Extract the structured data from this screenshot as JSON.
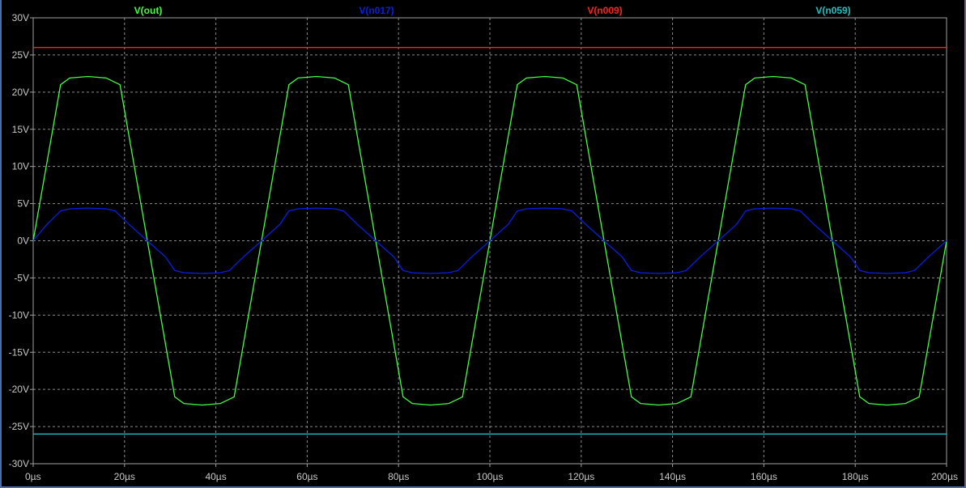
{
  "chart_data": {
    "type": "line",
    "x_unit": "µs",
    "xlim": [
      0,
      200
    ],
    "ylim": [
      -30,
      30
    ],
    "grid": true,
    "legend_placement": "top",
    "background": "#000000",
    "x_ticks": [
      {
        "value": 0,
        "label": "0µs"
      },
      {
        "value": 20,
        "label": "20µs"
      },
      {
        "value": 40,
        "label": "40µs"
      },
      {
        "value": 60,
        "label": "60µs"
      },
      {
        "value": 80,
        "label": "80µs"
      },
      {
        "value": 100,
        "label": "100µs"
      },
      {
        "value": 120,
        "label": "120µs"
      },
      {
        "value": 140,
        "label": "140µs"
      },
      {
        "value": 160,
        "label": "160µs"
      },
      {
        "value": 180,
        "label": "180µs"
      },
      {
        "value": 200,
        "label": "200µs"
      }
    ],
    "y_ticks": [
      {
        "value": 30,
        "label": "30V"
      },
      {
        "value": 25,
        "label": "25V"
      },
      {
        "value": 20,
        "label": "20V"
      },
      {
        "value": 15,
        "label": "15V"
      },
      {
        "value": 10,
        "label": "10V"
      },
      {
        "value": 5,
        "label": "5V"
      },
      {
        "value": 0,
        "label": "0V"
      },
      {
        "value": -5,
        "label": "-5V"
      },
      {
        "value": -10,
        "label": "-10V"
      },
      {
        "value": -15,
        "label": "-15V"
      },
      {
        "value": -20,
        "label": "-20V"
      },
      {
        "value": -25,
        "label": "-25V"
      },
      {
        "value": -30,
        "label": "-30V"
      }
    ],
    "series": [
      {
        "name": "V(out)",
        "color": "#40ff40",
        "x": [
          0,
          6,
          8,
          12,
          16,
          19,
          31,
          33,
          37,
          41,
          44,
          56,
          58,
          62,
          66,
          69,
          81,
          83,
          87,
          91,
          94,
          106,
          108,
          112,
          116,
          119,
          131,
          133,
          137,
          141,
          144,
          156,
          158,
          162,
          166,
          169,
          181,
          183,
          187,
          191,
          194,
          200
        ],
        "y": [
          0,
          21,
          21.9,
          22.1,
          21.9,
          21,
          -21,
          -21.9,
          -22.1,
          -21.9,
          -21,
          21,
          21.9,
          22.1,
          21.9,
          21,
          -21,
          -21.9,
          -22.1,
          -21.9,
          -21,
          21,
          21.9,
          22.1,
          21.9,
          21,
          -21,
          -21.9,
          -22.1,
          -21.9,
          -21,
          21,
          21.9,
          22.1,
          21.9,
          21,
          -21,
          -21.9,
          -22.1,
          -21.9,
          -21,
          0
        ]
      },
      {
        "name": "V(n017)",
        "color": "#0a1ee6",
        "x": [
          0,
          3,
          6,
          8,
          12,
          16,
          18,
          21,
          25,
          29,
          31,
          33,
          37,
          41,
          43,
          46,
          50,
          54,
          56,
          58,
          62,
          66,
          68,
          71,
          75,
          79,
          81,
          83,
          87,
          91,
          93,
          96,
          100,
          104,
          106,
          108,
          112,
          116,
          118,
          121,
          125,
          129,
          131,
          133,
          137,
          141,
          143,
          146,
          150,
          154,
          156,
          158,
          162,
          166,
          168,
          171,
          175,
          179,
          181,
          183,
          187,
          191,
          193,
          196,
          200
        ],
        "y": [
          0,
          2.2,
          4,
          4.3,
          4.4,
          4.3,
          4,
          2.2,
          0,
          -2.2,
          -4,
          -4.3,
          -4.4,
          -4.3,
          -4,
          -2.2,
          0,
          2.2,
          4,
          4.3,
          4.4,
          4.3,
          4,
          2.2,
          0,
          -2.2,
          -4,
          -4.3,
          -4.4,
          -4.3,
          -4,
          -2.2,
          0,
          2.2,
          4,
          4.3,
          4.4,
          4.3,
          4,
          2.2,
          0,
          -2.2,
          -4,
          -4.3,
          -4.4,
          -4.3,
          -4,
          -2.2,
          0,
          2.2,
          4,
          4.3,
          4.4,
          4.3,
          4,
          2.2,
          0,
          -2.2,
          -4,
          -4.3,
          -4.4,
          -4.3,
          -4,
          -2.2,
          0
        ]
      },
      {
        "name": "V(n009)",
        "color": "#ff2020",
        "x": [
          0,
          200
        ],
        "y": [
          26,
          26
        ]
      },
      {
        "name": "V(n059)",
        "color": "#20c0c0",
        "x": [
          0,
          200
        ],
        "y": [
          -26,
          -26
        ]
      }
    ]
  }
}
